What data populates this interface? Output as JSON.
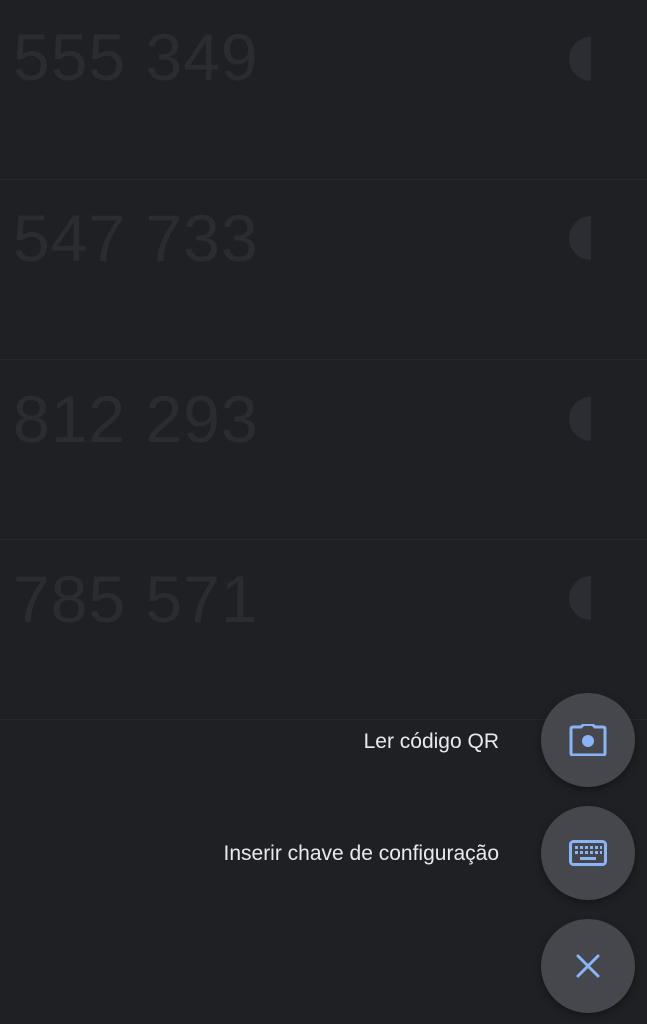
{
  "codes": [
    {
      "value": "555 349"
    },
    {
      "value": "547 733"
    },
    {
      "value": "812 293"
    },
    {
      "value": "785 571"
    }
  ],
  "fab_menu": {
    "scan_qr_label": "Ler código QR",
    "enter_key_label": "Inserir chave de configuração"
  },
  "icons": {
    "scan_qr": "camera-icon",
    "enter_key": "keyboard-icon",
    "close": "close-icon"
  },
  "colors": {
    "background": "#1f2023",
    "fab": "#45474c",
    "icon_accent": "#8ab4f8",
    "label_text": "#e8eaed"
  }
}
